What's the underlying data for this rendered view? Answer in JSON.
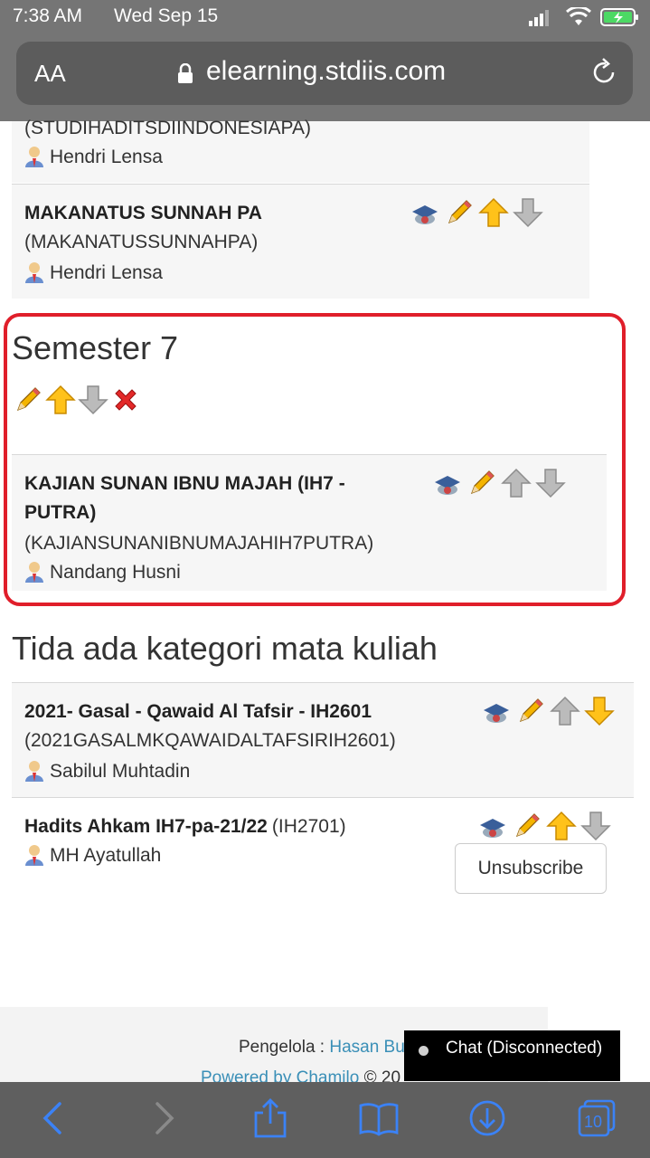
{
  "status_bar": {
    "time": "7:38 AM",
    "date": "Wed Sep 15"
  },
  "address_bar": {
    "text_size": "AA",
    "url": "elearning.stdiis.com"
  },
  "courses_top": [
    {
      "code": "(STUDIHADITSDIINDONESIAPA)",
      "teacher": "Hendri Lensa"
    },
    {
      "title": "MAKANATUS SUNNAH PA",
      "code": "(MAKANATUSSUNNAHPA)",
      "teacher": "Hendri Lensa"
    }
  ],
  "semester7": {
    "heading": "Semester 7",
    "course": {
      "title_line1": "KAJIAN SUNAN IBNU MAJAH (IH7 -",
      "title_line2": "PUTRA)",
      "code": "(KAJIANSUNANIBNUMAJAHIH7PUTRA)",
      "teacher": "Nandang Husni"
    }
  },
  "no_category": {
    "heading": "Tida ada kategori mata kuliah",
    "courses": [
      {
        "title": "2021- Gasal - Qawaid Al Tafsir - IH2601",
        "code": "(2021GASALMKQAWAIDALTAFSIRIH2601)",
        "teacher": "Sabilul Muhtadin"
      },
      {
        "title": "Hadits Ahkam IH7-pa-21/22",
        "code": "(IH2701)",
        "teacher": "MH Ayatullah",
        "action": "Unsubscribe"
      }
    ]
  },
  "footer": {
    "pengelola_label": "Pengelola :",
    "pengelola_name": "Hasan Bus",
    "powered": "Powered by Chamilo",
    "copyright": "© 20"
  },
  "chat": {
    "label": "Chat (Disconnected)"
  },
  "toolbar": {
    "tabs_count": "10"
  },
  "colors": {
    "highlight": "#e01e2a",
    "link": "#3a8fb7"
  }
}
